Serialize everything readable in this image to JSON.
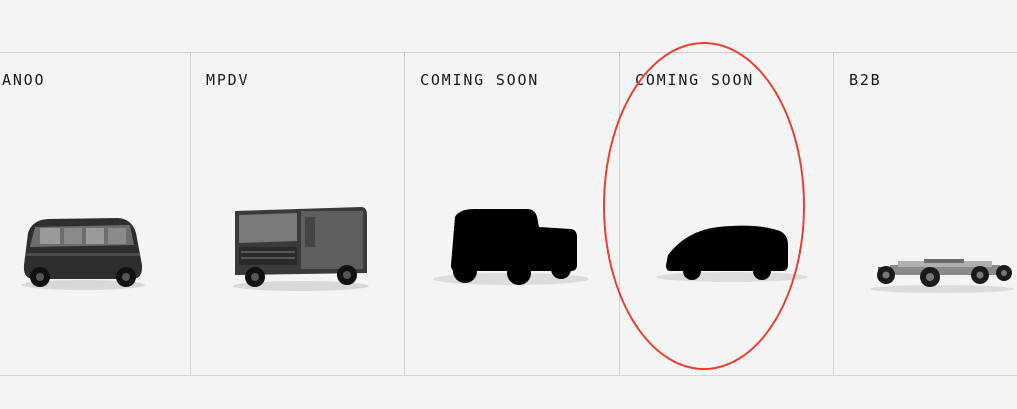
{
  "vehicles": {
    "items": [
      {
        "label": "ANOO",
        "image": "lifestyle-vehicle-image"
      },
      {
        "label": "MPDV",
        "image": "delivery-van-image"
      },
      {
        "label": "COMING SOON",
        "image": "pickup-truck-silhouette"
      },
      {
        "label": "COMING SOON",
        "image": "sedan-silhouette"
      },
      {
        "label": "B2B",
        "image": "skateboard-chassis-image"
      }
    ]
  },
  "colors": {
    "background": "#f4f4f4",
    "divider": "#d3d3d3",
    "text": "#1a1a1a",
    "annotation": "#e8402f"
  }
}
